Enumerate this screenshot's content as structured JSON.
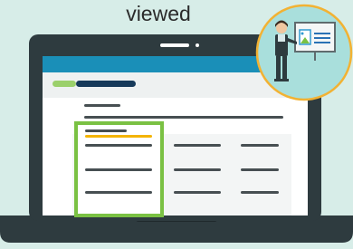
{
  "caption": "viewed",
  "colors": {
    "background": "#d7ede8",
    "laptop_body": "#2e3b3f",
    "screen": "#ffffff",
    "header_bar": "#1a8fb8",
    "header_band": "#eef1f1",
    "tag_green": "#9bd06b",
    "tag_navy": "#163a5a",
    "highlight_box": "#7ac143",
    "highlight_underline": "#f4b400",
    "text_line": "#474f52",
    "badge_circle": "#a9dfdc",
    "badge_ring": "#f2b233"
  },
  "icons": {
    "badge": "presenter-icon",
    "camera": "webcam-dot-icon"
  }
}
